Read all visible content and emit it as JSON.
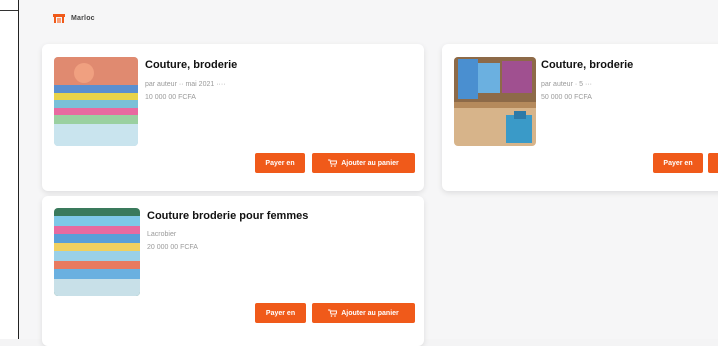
{
  "brand": {
    "name": "Marloc"
  },
  "colors": {
    "accent": "#f05a1a"
  },
  "products": [
    {
      "title": "Couture, broderie",
      "line1": "par auteur ·· mai 2021 ····",
      "line2": "10 000 00 FCFA",
      "buy_label": "Payer en",
      "cart_label": "Ajouter au panier"
    },
    {
      "title": "Couture, broderie",
      "line1": "par auteur · 5 ···",
      "line2": "50 000 00 FCFA",
      "buy_label": "Payer en",
      "cart_label": ""
    },
    {
      "title": "Couture broderie pour femmes",
      "line1": "Lacrobier",
      "line2": "20 000 00 FCFA",
      "buy_label": "Payer en",
      "cart_label": "Ajouter au panier"
    }
  ]
}
